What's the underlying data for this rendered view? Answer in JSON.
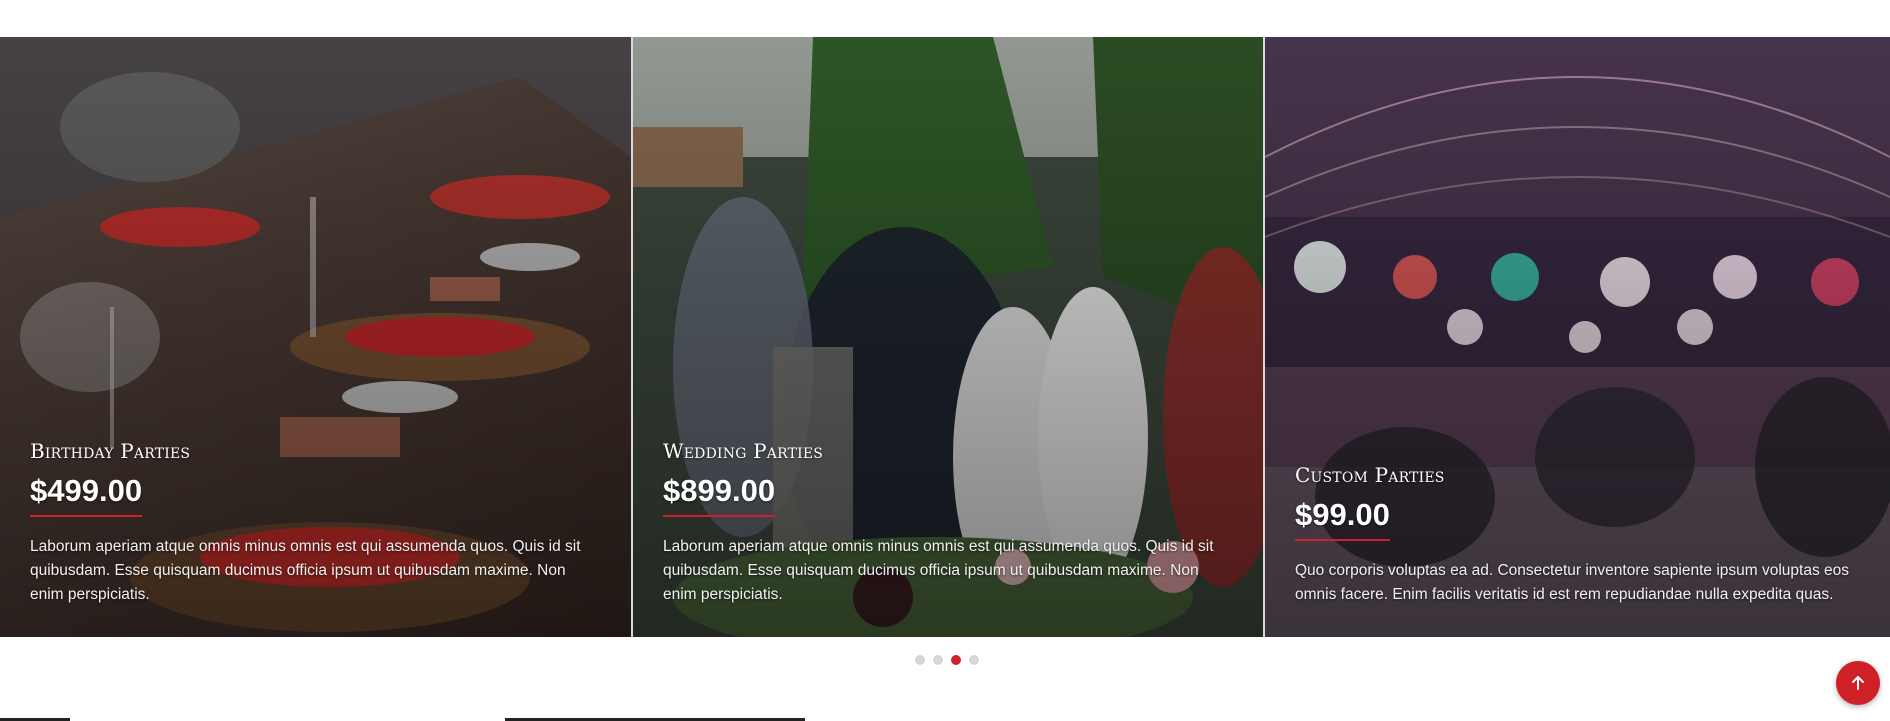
{
  "slides": [
    {
      "title": "Birthday Parties",
      "price": "$499.00",
      "description": "Laborum aperiam atque omnis minus omnis est qui assumenda quos. Quis id sit quibusdam. Esse quisquam ducimus officia ipsum ut quibusdam maxime. Non enim perspiciatis."
    },
    {
      "title": "Wedding Parties",
      "price": "$899.00",
      "description": "Laborum aperiam atque omnis minus omnis est qui assumenda quos. Quis id sit quibusdam. Esse quisquam ducimus officia ipsum ut quibusdam maxime. Non enim perspiciatis."
    },
    {
      "title": "Custom Parties",
      "price": "$99.00",
      "description": "Quo corporis voluptas ea ad. Consectetur inventore sapiente ipsum voluptas eos omnis facere. Enim facilis veritatis id est rem repudiandae nulla expedita quas."
    }
  ],
  "pagination": {
    "total": 4,
    "active_index": 2
  },
  "back_to_top_icon": "arrow-up-icon",
  "colors": {
    "accent": "#cf1f27",
    "dot_inactive": "#d6d6d6"
  }
}
